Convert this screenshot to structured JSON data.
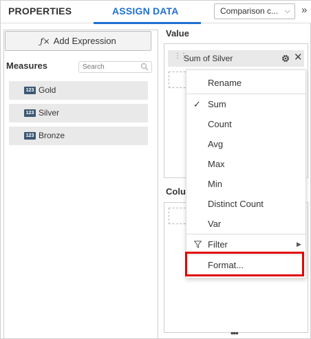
{
  "header": {
    "tab_properties": "PROPERTIES",
    "tab_assign": "ASSIGN DATA",
    "widget_select": "Comparison c...",
    "collapse_glyph": "»"
  },
  "left": {
    "add_expression": "Add Expression",
    "fx_glyph": "ƒ×",
    "measures_title": "Measures",
    "search_placeholder": "Search",
    "badge": "123",
    "measures": [
      {
        "label": "Gold"
      },
      {
        "label": "Silver"
      },
      {
        "label": "Bronze"
      }
    ]
  },
  "right": {
    "value_title": "Value",
    "value_pill": "Sum of Silver",
    "column_title": "Colu",
    "more": "•••"
  },
  "menu": {
    "items": [
      "Rename",
      "Sum",
      "Count",
      "Avg",
      "Max",
      "Min",
      "Distinct Count",
      "Var",
      "Filter",
      "Format..."
    ],
    "checked": "Sum",
    "check_glyph": "✓",
    "submenu_glyph": "▶"
  },
  "colors": {
    "accent": "#1f6fd0",
    "highlight": "#e00000",
    "badge": "#3d5873",
    "item_bg": "#e9e9e9"
  },
  "icons": [
    "search-icon",
    "gear-icon",
    "close-icon",
    "grip-icon",
    "check-icon",
    "filter-icon",
    "chevron-down-icon",
    "double-chevron-right-icon"
  ]
}
